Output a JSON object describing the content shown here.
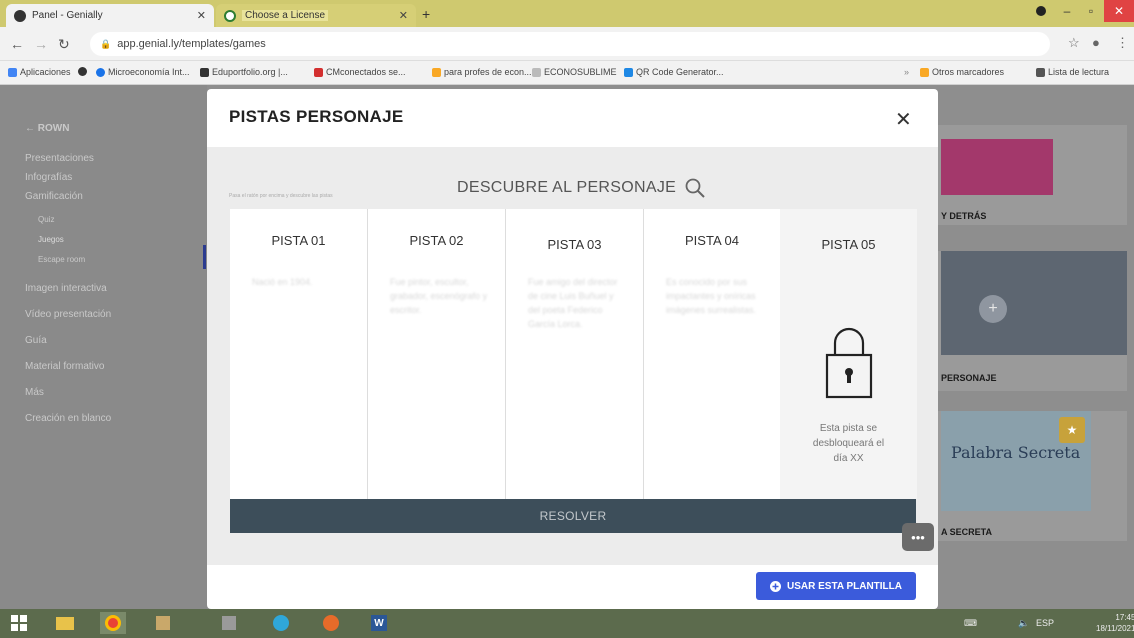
{
  "browser": {
    "tabs": [
      {
        "label": "Panel - Genially",
        "active": true,
        "favicon_color": "#333333"
      },
      {
        "label": "Choose a License",
        "active": false,
        "favicon_color": "#2e7d32"
      }
    ],
    "url": "app.genial.ly/templates/games",
    "bookmarks": [
      {
        "label": "Aplicaciones",
        "icon": "apps-icon",
        "color": "#4285f4"
      },
      {
        "label": "",
        "icon": "github-icon",
        "color": "#333333"
      },
      {
        "label": "Microeconomía Int...",
        "icon": "globe-icon",
        "color": "#1a73e8"
      },
      {
        "label": "Eduportfolio.org |...",
        "icon": "eduportfolio-icon",
        "color": "#333333"
      },
      {
        "label": "CMconectados se...",
        "icon": "cm-icon",
        "color": "#d32f2f"
      },
      {
        "label": "para profes de econ...",
        "icon": "drive-icon",
        "color": "#f9a825"
      },
      {
        "label": "ECONOSUBLIME",
        "icon": "file-icon",
        "color": "#777777"
      },
      {
        "label": "QR Code Generator...",
        "icon": "qr-icon",
        "color": "#1e88e5"
      },
      {
        "label": "Otros marcadores",
        "icon": "folder-icon",
        "color": "#f9a825"
      },
      {
        "label": "Lista de lectura",
        "icon": "reading-list-icon",
        "color": "#555555"
      }
    ]
  },
  "sidebar": {
    "brand": "← ROWN",
    "items": [
      {
        "label": "Presentaciones"
      },
      {
        "label": "Infografías"
      },
      {
        "label": "Gamificación"
      },
      {
        "label": "Quiz"
      },
      {
        "label": "Juegos"
      },
      {
        "label": "Escape room"
      },
      {
        "label": "Imagen interactiva"
      },
      {
        "label": "Vídeo presentación"
      },
      {
        "label": "Guía"
      },
      {
        "label": "Material formativo"
      },
      {
        "label": "Más"
      },
      {
        "label": "Creación en blanco"
      }
    ]
  },
  "right_cards": [
    {
      "label": "Y DETRÁS"
    },
    {
      "label": "PERSONAJE"
    },
    {
      "label": "A SECRETA",
      "thumb_text": "Palabra Secreta"
    }
  ],
  "modal": {
    "title": "PISTAS PERSONAJE",
    "preview": {
      "heading": "DESCUBRE AL PERSONAJE",
      "small_text": "Pasa el ratón por encima y descubre las pistas",
      "cards": [
        {
          "title": "PISTA 01",
          "text": "Nació en 1904."
        },
        {
          "title": "PISTA 02",
          "text": "Fue pintor, escultor, grabador, escenógrafo y escritor."
        },
        {
          "title": "PISTA 03",
          "text": "Fue amigo del director de cine Luis Buñuel y del poeta Federico García Lorca."
        },
        {
          "title": "PISTA 04",
          "text": "Es conocido por sus impactantes y oníricas imágenes surrealistas."
        },
        {
          "title": "PISTA 05",
          "locked_text": "Esta pista se desbloqueará el día XX"
        }
      ],
      "resolve_label": "RESOLVER"
    },
    "more_label": "•••",
    "use_template_label": "USAR ESTA PLANTILLA"
  },
  "taskbar": {
    "time": "17:45",
    "date": "18/11/2021",
    "lang": "ESP"
  }
}
